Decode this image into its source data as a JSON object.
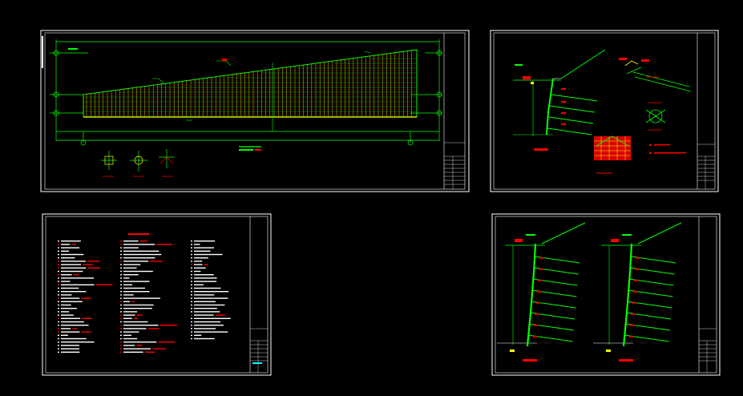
{
  "colors": {
    "background": "#000000",
    "frame": "#ffffff",
    "primary_line": "#00ff00",
    "secondary_line": "#ffff00",
    "annotation": "#ff0000",
    "leader": "#00ffff"
  },
  "sheets": [
    {
      "id": "elevation",
      "content": "soil-nail-wall-elevation"
    },
    {
      "id": "section-detail",
      "content": "wall-section-with-nail-details"
    },
    {
      "id": "notes",
      "content": "design-notes-text"
    },
    {
      "id": "sections-pair",
      "content": "two-wall-sections"
    }
  ]
}
